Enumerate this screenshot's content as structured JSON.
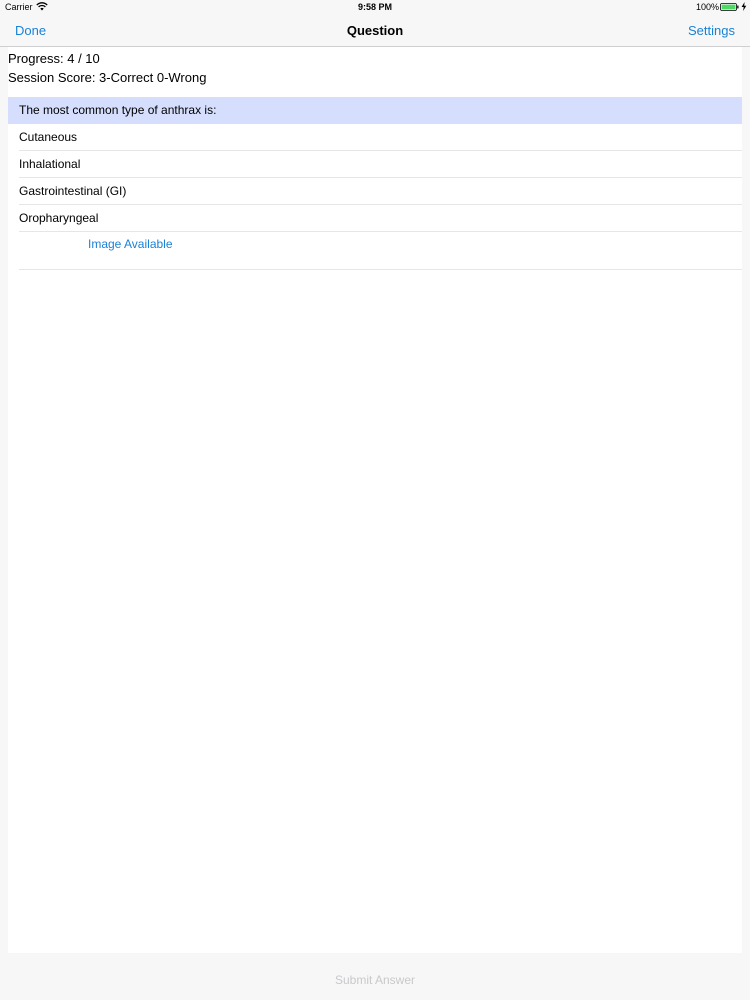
{
  "status_bar": {
    "carrier": "Carrier",
    "time": "9:58 PM",
    "battery": "100%",
    "icons": [
      "wifi-icon",
      "battery-icon",
      "charging-bolt-icon"
    ],
    "battery_color": "#4cd964"
  },
  "nav": {
    "done_label": "Done",
    "title": "Question",
    "settings_label": "Settings"
  },
  "progress": {
    "progress_text": "Progress: 4 / 10",
    "score_text": "Session Score: 3-Correct 0-Wrong"
  },
  "question": {
    "text": "The most common type of anthrax is:",
    "answers": [
      {
        "label": "Cutaneous"
      },
      {
        "label": "Inhalational"
      },
      {
        "label": "Gastrointestinal (GI)"
      },
      {
        "label": "Oropharyngeal"
      }
    ],
    "image_link": "Image Available"
  },
  "toolbar": {
    "submit_label": "Submit Answer",
    "submit_enabled": false
  },
  "colors": {
    "accent": "#1a82d6",
    "question_highlight": "#d5defd",
    "disabled_text": "#c9c9cc"
  }
}
